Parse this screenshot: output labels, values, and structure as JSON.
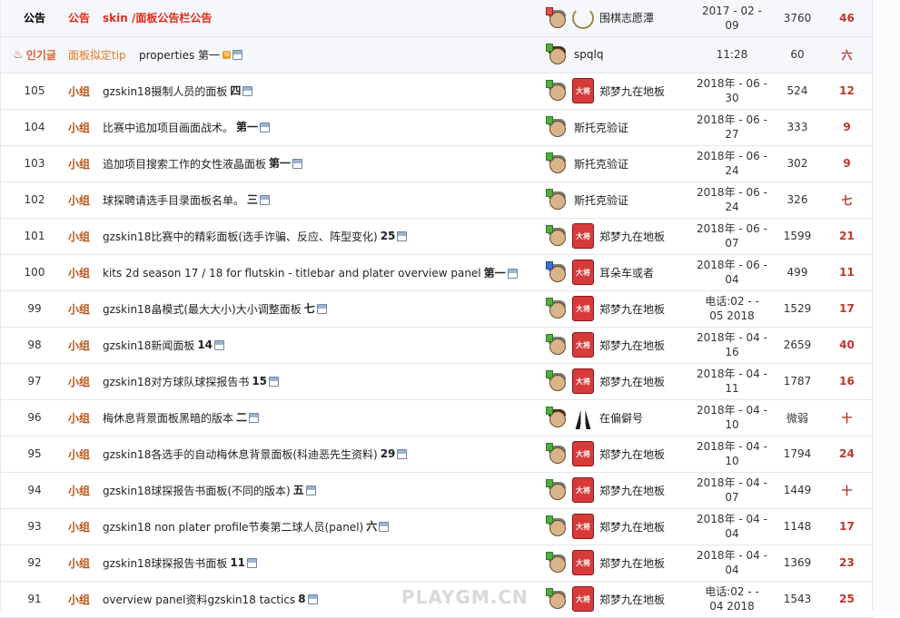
{
  "notice_row": {
    "num": "公告",
    "cat": "公告",
    "title": "skin /面板公告栏公告",
    "author": "围棋志愿潭",
    "date_line1": "2017 - 02 -",
    "date_line2": "09",
    "views": "3760",
    "comments": "46"
  },
  "hot_row": {
    "num": "인기글",
    "cat": "面板拟定tip",
    "title": "properties 第一",
    "author": "spqlq",
    "date_line1": "11:28",
    "date_line2": "",
    "views": "60",
    "comments": "六"
  },
  "posts": [
    {
      "num": "105",
      "cat": "小组",
      "title": "gzskin18摄制人员的面板",
      "count": "四",
      "author": "郑梦九在地板",
      "date_line1": "2018年 - 06 -",
      "date_line2": "30",
      "views": "524",
      "comments": "12",
      "avatar": "gray",
      "badge": true
    },
    {
      "num": "104",
      "cat": "小组",
      "title": "比赛中追加项目画面战术。",
      "count": "第一",
      "author": "斯托克验证",
      "date_line1": "2018年 - 06 -",
      "date_line2": "27",
      "views": "333",
      "comments": "9",
      "avatar": "gray",
      "badge": false
    },
    {
      "num": "103",
      "cat": "小组",
      "title": "追加项目搜索工作的女性液晶面板",
      "count": "第一",
      "author": "斯托克验证",
      "date_line1": "2018年 - 06 -",
      "date_line2": "24",
      "views": "302",
      "comments": "9",
      "avatar": "gray",
      "badge": false
    },
    {
      "num": "102",
      "cat": "小组",
      "title": "球探聘请选手目录面板名单。",
      "count": "三",
      "author": "斯托克验证",
      "date_line1": "2018年 - 06 -",
      "date_line2": "24",
      "views": "326",
      "comments": "七",
      "avatar": "gray",
      "badge": false
    },
    {
      "num": "101",
      "cat": "小组",
      "title": "gzskin18比赛中的精彩面板(选手诈骗、反应、阵型变化)",
      "count": "25",
      "author": "郑梦九在地板",
      "date_line1": "2018年 - 06 -",
      "date_line2": "07",
      "views": "1599",
      "comments": "21",
      "avatar": "gray",
      "badge": true
    },
    {
      "num": "100",
      "cat": "小组",
      "title": "kits 2d season 17 / 18 for flutskin - titlebar and plater overview panel",
      "count": "第一",
      "author": "耳朵车或者",
      "date_line1": "2018年 - 06 -",
      "date_line2": "04",
      "views": "499",
      "comments": "11",
      "avatar": "blue",
      "badge": true
    },
    {
      "num": "99",
      "cat": "小组",
      "title": "gzskin18畠模式(最大大小)大小调整面板",
      "count": "七",
      "author": "郑梦九在地板",
      "date_line1": "电话:02 - -",
      "date_line2": "05 2018",
      "views": "1529",
      "comments": "17",
      "avatar": "gray",
      "badge": true
    },
    {
      "num": "98",
      "cat": "小组",
      "title": "gzskin18新闻面板",
      "count": "14",
      "author": "郑梦九在地板",
      "date_line1": "2018年 - 04 -",
      "date_line2": "16",
      "views": "2659",
      "comments": "40",
      "avatar": "gray",
      "badge": true
    },
    {
      "num": "97",
      "cat": "小组",
      "title": "gzskin18对方球队球探报告书",
      "count": "15",
      "author": "郑梦九在地板",
      "date_line1": "2018年 - 04 -",
      "date_line2": "11",
      "views": "1787",
      "comments": "16",
      "avatar": "gray",
      "badge": true
    },
    {
      "num": "96",
      "cat": "小组",
      "title": "梅休息背景面板黑暗的版本",
      "count": "二",
      "author": "在偏僻号",
      "date_line1": "2018年 - 04 -",
      "date_line2": "10",
      "views": "微弱",
      "comments": "十",
      "avatar": "brown",
      "badge": false,
      "legs": true
    },
    {
      "num": "95",
      "cat": "小组",
      "title": "gzskin18各选手的自动梅休息背景面板(科迪恶先生资料)",
      "count": "29",
      "author": "郑梦九在地板",
      "date_line1": "2018年 - 04 -",
      "date_line2": "10",
      "views": "1794",
      "comments": "24",
      "avatar": "gray",
      "badge": true
    },
    {
      "num": "94",
      "cat": "小组",
      "title": "gzskin18球探报告书面板(不同的版本)",
      "count": "五",
      "author": "郑梦九在地板",
      "date_line1": "2018年 - 04 -",
      "date_line2": "07",
      "views": "1449",
      "comments": "十",
      "avatar": "gray",
      "badge": true
    },
    {
      "num": "93",
      "cat": "小组",
      "title": "gzskin18 non plater profile节奏第二球人员(panel)",
      "count": "六",
      "author": "郑梦九在地板",
      "date_line1": "2018年 - 04 -",
      "date_line2": "04",
      "views": "1148",
      "comments": "17",
      "avatar": "gray",
      "badge": true
    },
    {
      "num": "92",
      "cat": "小组",
      "title": "gzskin18球探报告书面板",
      "count": "11",
      "author": "郑梦九在地板",
      "date_line1": "2018年 - 04 -",
      "date_line2": "04",
      "views": "1369",
      "comments": "23",
      "avatar": "gray",
      "badge": true
    },
    {
      "num": "91",
      "cat": "小组",
      "title": "overview panel资料gzskin18 tactics",
      "count": "8",
      "author": "郑梦九在地板",
      "date_line1": "电话:02 - -",
      "date_line2": "04 2018",
      "views": "1543",
      "comments": "25",
      "avatar": "gray",
      "badge": true
    }
  ],
  "badge_text": "大将",
  "watermark": "PLAYGM.CN"
}
